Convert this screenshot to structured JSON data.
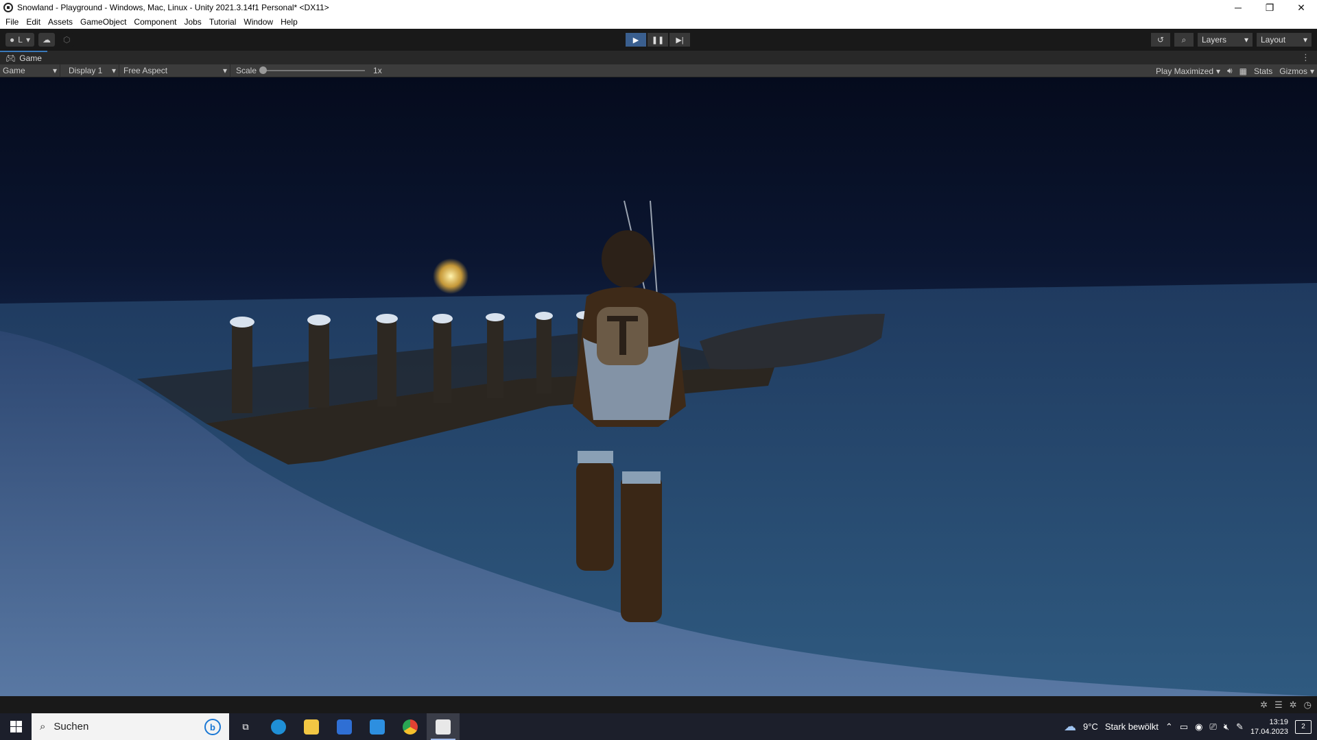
{
  "window": {
    "title": "Snowland - Playground - Windows, Mac, Linux - Unity 2021.3.14f1 Personal* <DX11>",
    "minimize": "─",
    "restore": "❐",
    "close": "✕"
  },
  "menu": [
    "File",
    "Edit",
    "Assets",
    "GameObject",
    "Component",
    "Jobs",
    "Tutorial",
    "Window",
    "Help"
  ],
  "toolbar": {
    "account_label": "L",
    "play_icon": "▶",
    "pause_icon": "❚❚",
    "step_icon": "▶|",
    "history_icon": "↺",
    "search_icon": "⌕",
    "layers_label": "Layers",
    "layout_label": "Layout",
    "play_active_color": "#3a5f8f"
  },
  "game_tab": {
    "tab_label": "Game",
    "view_select": "Game",
    "display_select": "Display 1",
    "aspect_select": "Free Aspect",
    "scale_label": "Scale",
    "scale_value": "1x",
    "scale_level": 0.0,
    "play_mode": "Play Maximized",
    "stats_label": "Stats",
    "gizmos_label": "Gizmos",
    "audio_icon": "speaker-icon",
    "grid_icon": "grid-icon"
  },
  "taskbar": {
    "search_placeholder": "Suchen",
    "bing_label": "b",
    "weather_temp": "9°C",
    "weather_desc": "Stark bewölkt",
    "time": "13:19",
    "date": "17.04.2023",
    "notifications": "2"
  }
}
